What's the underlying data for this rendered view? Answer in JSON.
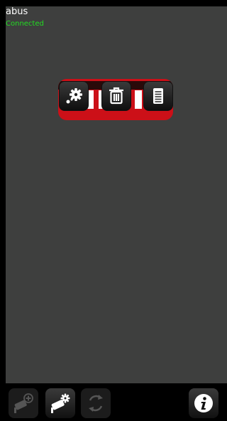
{
  "device": {
    "name": "abus",
    "status": "Connected",
    "status_color": "#22dd22"
  },
  "popup": {
    "actions": [
      {
        "icon": "gear-icon",
        "enabled": true
      },
      {
        "icon": "trash-icon",
        "enabled": true
      },
      {
        "icon": "document-icon",
        "enabled": true
      }
    ]
  },
  "toolbar": {
    "buttons": [
      {
        "icon": "add-camera-icon",
        "enabled": false
      },
      {
        "icon": "camera-settings-icon",
        "enabled": true
      },
      {
        "icon": "refresh-icon",
        "enabled": false
      },
      {
        "icon": "info-icon",
        "enabled": true
      }
    ]
  }
}
